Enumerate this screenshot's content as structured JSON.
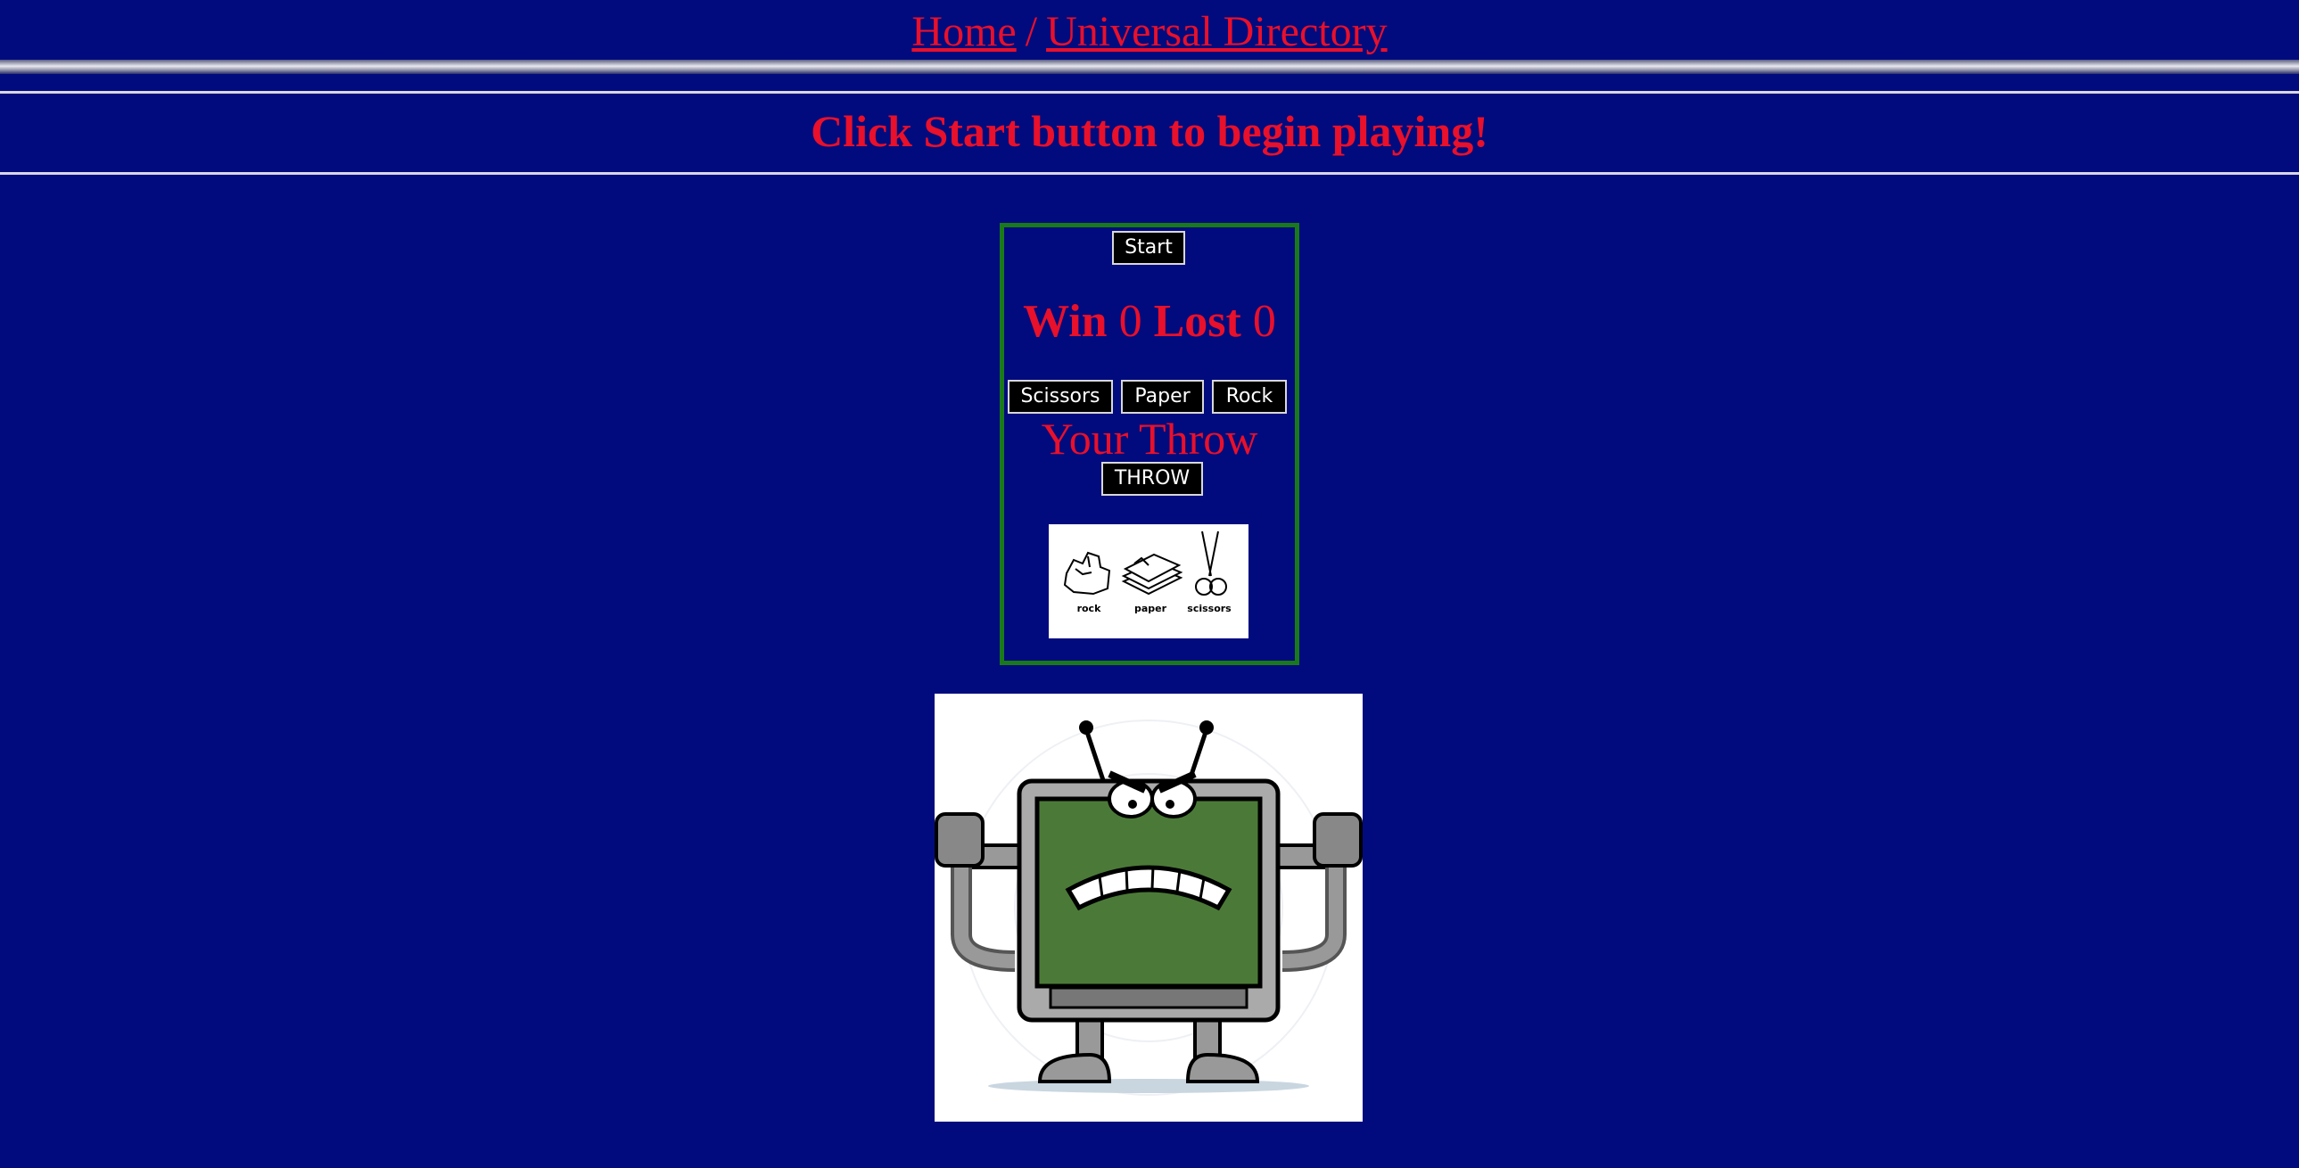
{
  "breadcrumb": {
    "home": "Home",
    "separator": "/",
    "directory": "Universal Directory"
  },
  "headline": "Click Start button to begin playing!",
  "game": {
    "start_label": "Start",
    "win_label": "Win",
    "win_count": "0",
    "lost_label": "Lost",
    "lost_count": "0",
    "choices": [
      "Scissors",
      "Paper",
      "Rock"
    ],
    "your_throw_label": "Your Throw",
    "throw_label": "THROW",
    "legend": {
      "rock": "rock",
      "paper": "paper",
      "scissors": "scissors"
    }
  },
  "colors": {
    "background": "#020b7e",
    "accent": "#e8102a",
    "game_border": "#1a7a1a",
    "screen": "#4b7a38"
  },
  "images": {
    "rps_image": "rock-paper-scissors-illustration",
    "robot_image": "angry-computer-robot-cartoon"
  }
}
